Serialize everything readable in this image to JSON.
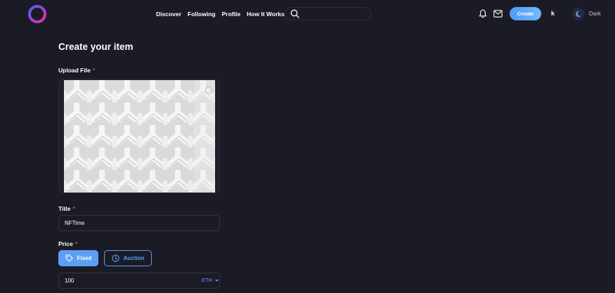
{
  "header": {
    "nav": [
      "Discover",
      "Following",
      "Profile",
      "How It Works"
    ],
    "search": {
      "placeholder": "",
      "value": ""
    },
    "create_label": "Create",
    "user_initial": "k",
    "theme_label": "Dark"
  },
  "form": {
    "title": "Create your item",
    "upload_label": "Upload File",
    "title_label": "Title",
    "title_value": "NFTime",
    "price_label": "Price",
    "price_options": [
      "Fixed",
      "Auction"
    ],
    "price_value": "100",
    "currency": "ETH",
    "required_mark": "*"
  },
  "colors": {
    "background": "#1b1b26",
    "accent": "#5d9ff3",
    "required": "#e34a4a"
  },
  "icons": [
    "logo-icon",
    "search-icon",
    "bell-icon",
    "mail-icon",
    "moon-icon",
    "tag-icon",
    "clock-icon",
    "chevron-down-icon"
  ]
}
